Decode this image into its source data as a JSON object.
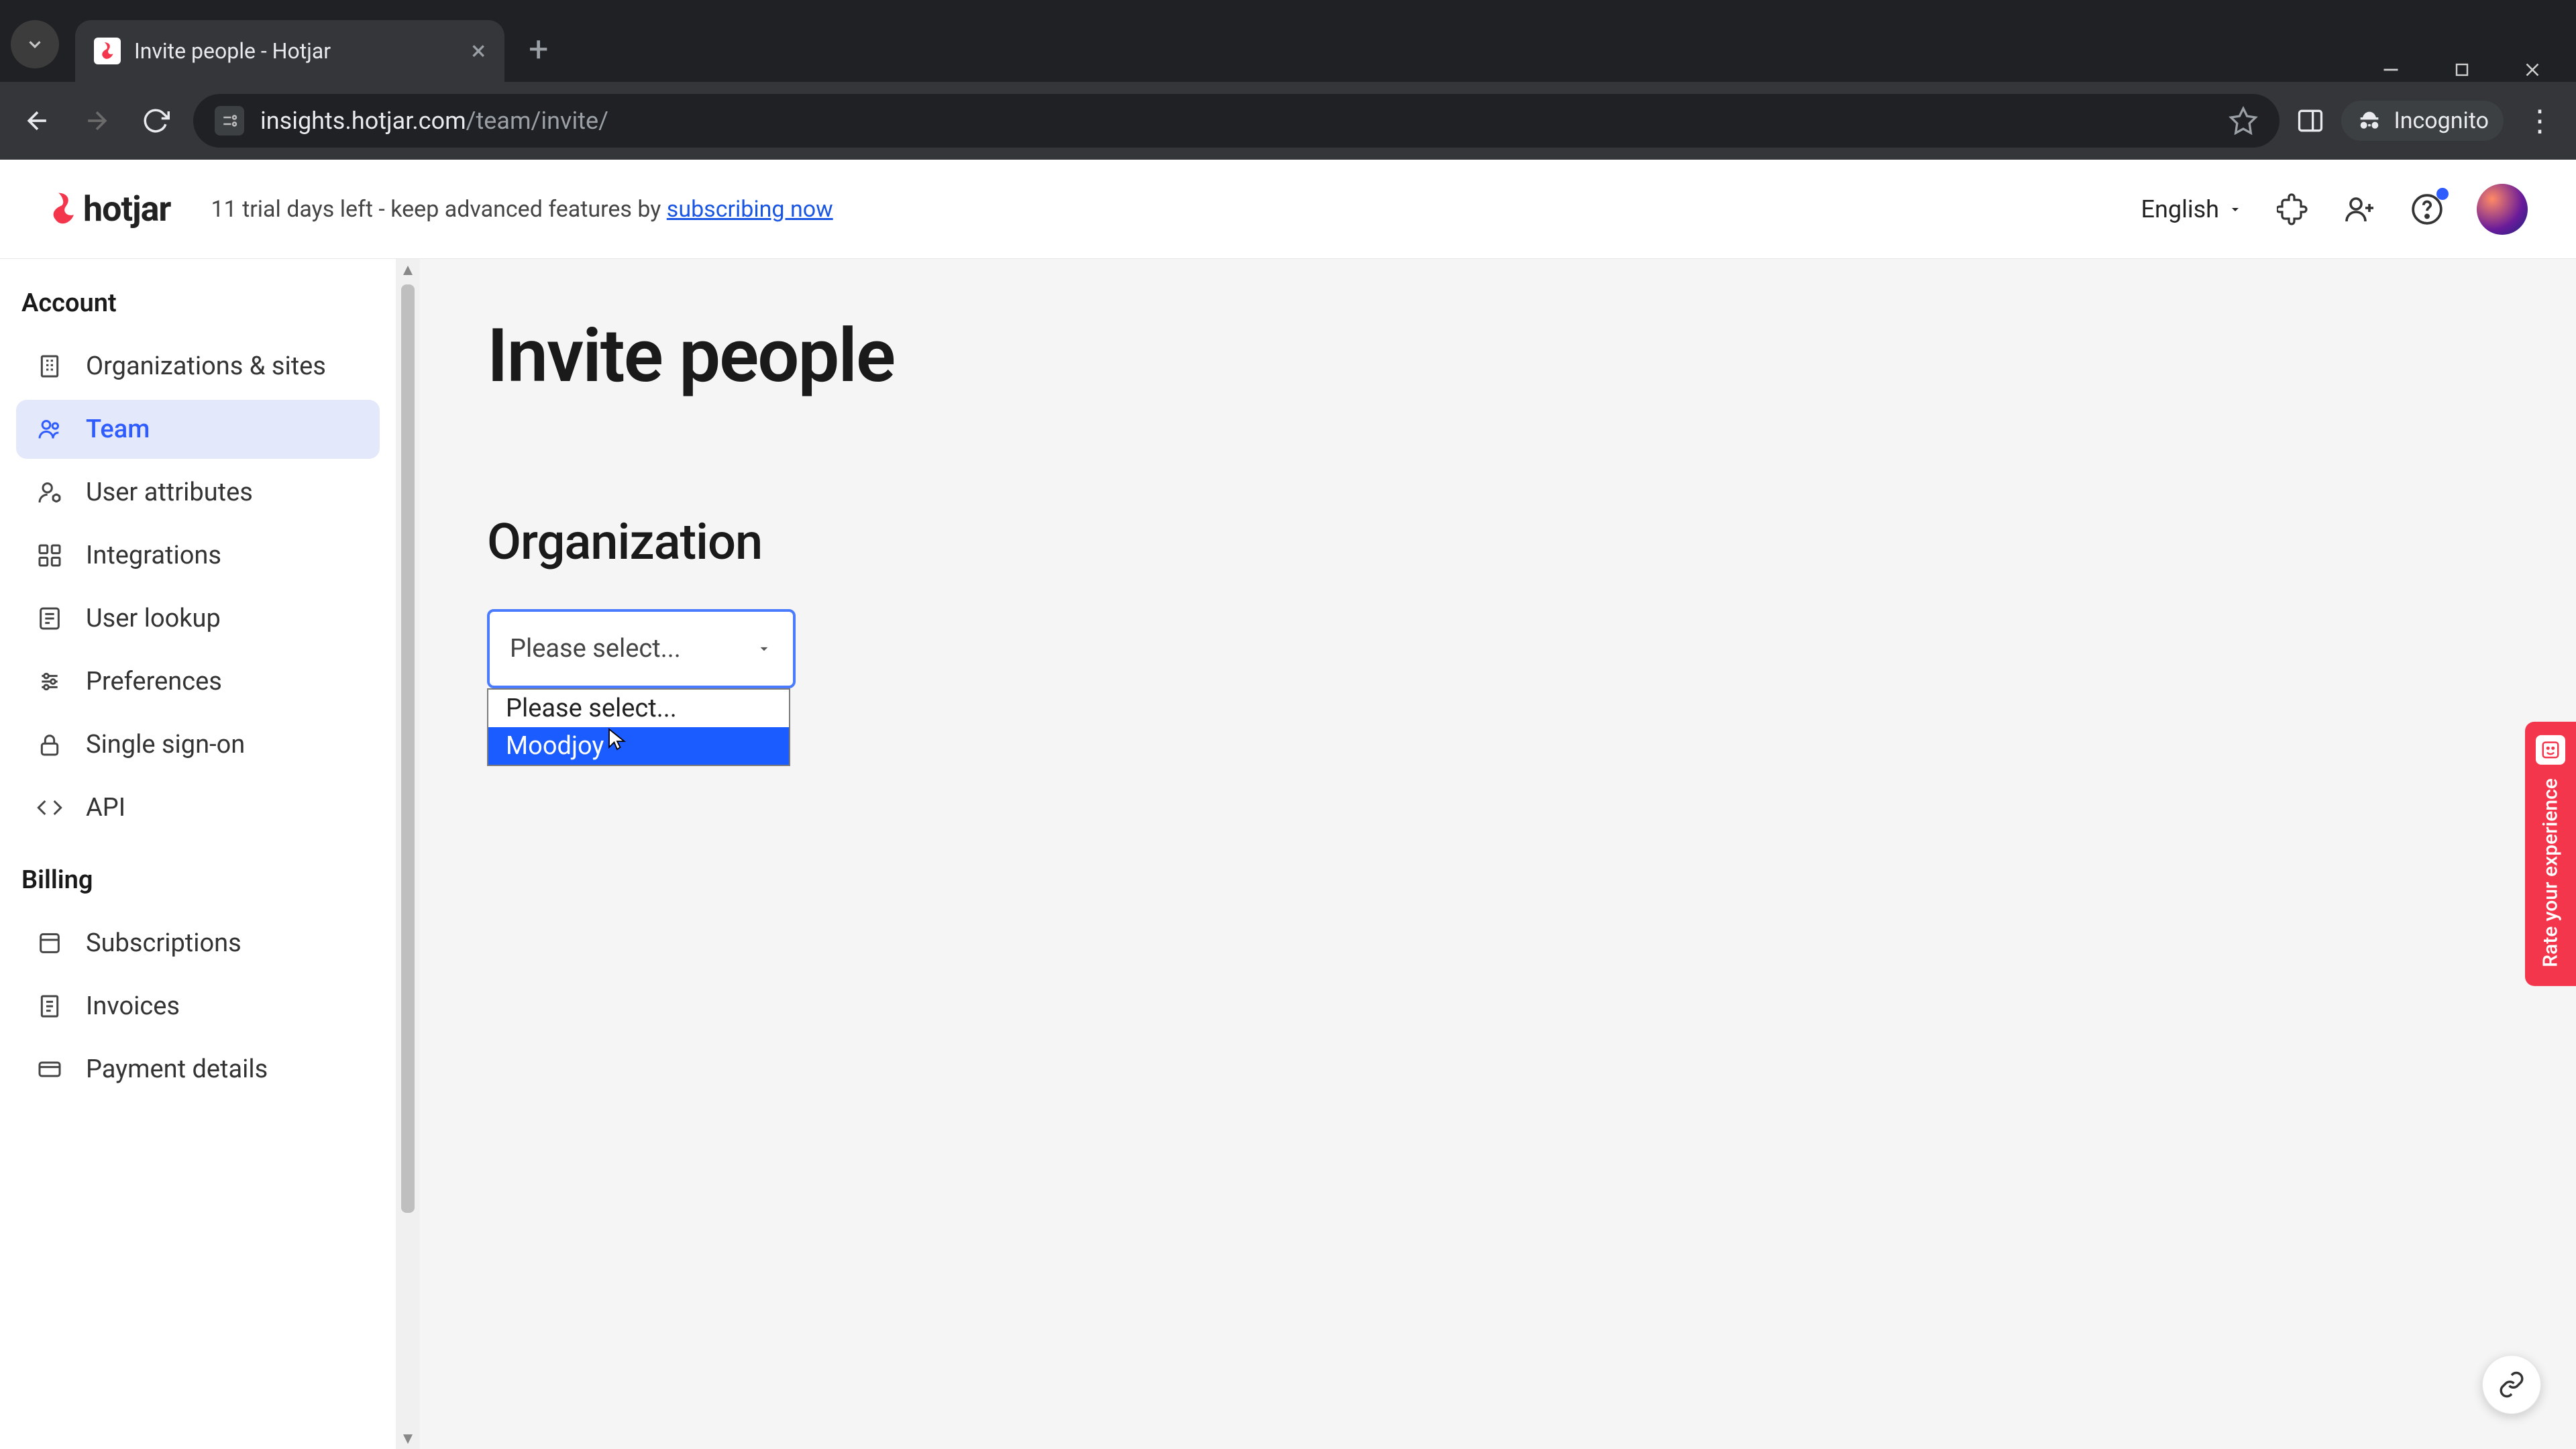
{
  "browser": {
    "tab_title": "Invite people - Hotjar",
    "url_host": "insights.hotjar.com",
    "url_path": "/team/invite/",
    "incognito_label": "Incognito"
  },
  "header": {
    "logo_text": "hotjar",
    "trial_prefix": "11 trial days left - keep advanced features by ",
    "trial_link": "subscribing now",
    "language": "English"
  },
  "sidebar": {
    "section_account": "Account",
    "items_account": [
      {
        "label": "Organizations & sites"
      },
      {
        "label": "Team"
      },
      {
        "label": "User attributes"
      },
      {
        "label": "Integrations"
      },
      {
        "label": "User lookup"
      },
      {
        "label": "Preferences"
      },
      {
        "label": "Single sign-on"
      },
      {
        "label": "API"
      }
    ],
    "section_billing": "Billing",
    "items_billing": [
      {
        "label": "Subscriptions"
      },
      {
        "label": "Invoices"
      },
      {
        "label": "Payment details"
      }
    ]
  },
  "main": {
    "title": "Invite people",
    "section": "Organization",
    "select_placeholder": "Please select...",
    "options": [
      "Please select...",
      "Moodjoy"
    ]
  },
  "rate_label": "Rate your experience"
}
